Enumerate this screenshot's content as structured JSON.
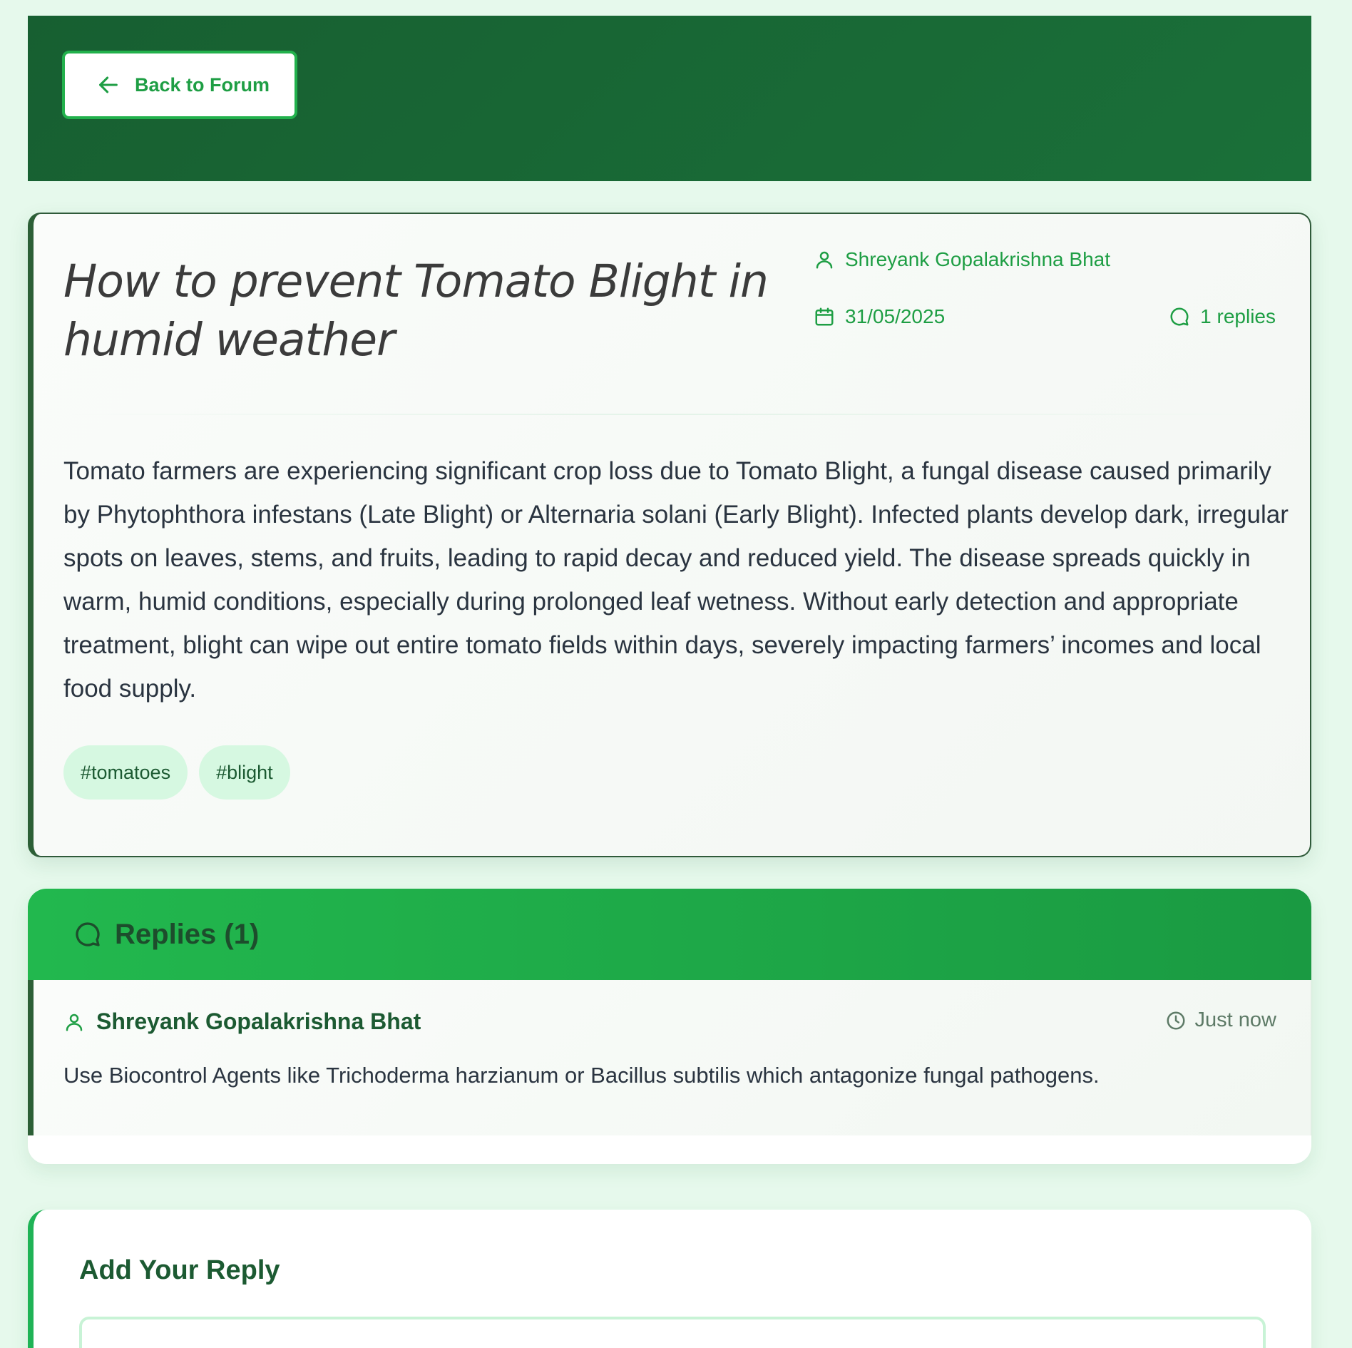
{
  "header": {
    "back_label": "Back to Forum",
    "colors": {
      "header_bg": "#175f31",
      "accent": "#22b14c"
    }
  },
  "post": {
    "title": "How to prevent Tomato Blight in humid weather",
    "author": "Shreyank Gopalakrishna Bhat",
    "date": "31/05/2025",
    "replies_count_label": "1 replies",
    "body": "Tomato farmers are experiencing significant crop loss due to Tomato Blight, a fungal disease caused primarily by Phytophthora infestans (Late Blight) or Alternaria solani (Early Blight). Infected plants develop dark, irregular spots on leaves, stems, and fruits, leading to rapid decay and reduced yield. The disease spreads quickly in warm, humid conditions, especially during prolonged leaf wetness. Without early detection and appropriate treatment, blight can wipe out entire tomato fields within days, severely impacting farmers’ incomes and local food supply.",
    "tags": [
      "#tomatoes",
      "#blight"
    ],
    "icons": {
      "author": "user-icon",
      "date": "calendar-icon",
      "replies": "chat-bubble-icon"
    }
  },
  "replies": {
    "heading": "Replies (1)",
    "items": [
      {
        "author": "Shreyank Gopalakrishna Bhat",
        "time": "Just now",
        "text": "Use Biocontrol Agents like Trichoderma harzianum or Bacillus subtilis which antagonize fungal pathogens."
      }
    ]
  },
  "add_reply": {
    "heading": "Add Your Reply",
    "textarea_value": ""
  }
}
